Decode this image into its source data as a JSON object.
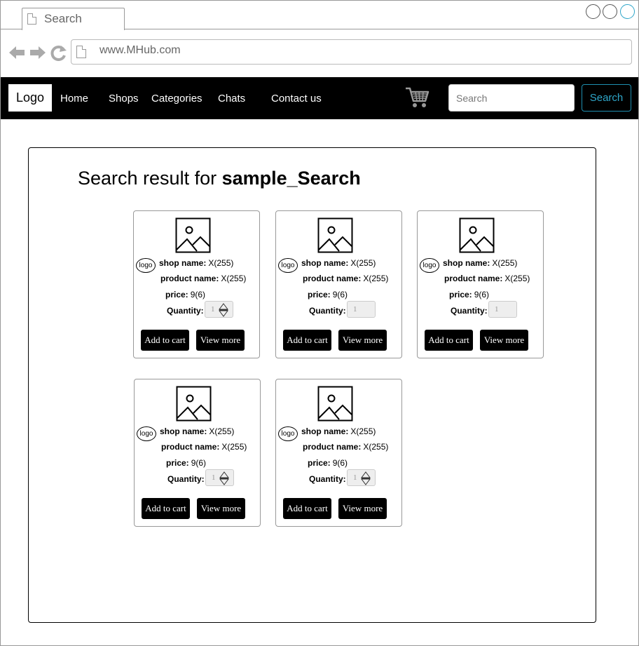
{
  "browser": {
    "tab_title": "Search",
    "url": "www.MHub.com"
  },
  "navbar": {
    "logo": "Logo",
    "links": [
      "Home",
      "Shops",
      "Categories",
      "Chats",
      "Contact us"
    ],
    "search_placeholder": "Search",
    "search_button": "Search"
  },
  "results": {
    "heading_prefix": "Search result for ",
    "query": "sample_Search"
  },
  "card_labels": {
    "shop_logo": "logo",
    "shop_name": "shop name:",
    "product_name": "product name:",
    "price": "price:",
    "quantity": "Quantity:",
    "add_to_cart": "Add to cart",
    "view_more": "View more"
  },
  "products": [
    {
      "shop_name": "X(255)",
      "product_name": "X(255)",
      "price": "9(6)",
      "quantity": "1",
      "has_spinner": true
    },
    {
      "shop_name": "X(255)",
      "product_name": "X(255)",
      "price": "9(6)",
      "quantity": "1",
      "has_spinner": false
    },
    {
      "shop_name": "X(255)",
      "product_name": "X(255)",
      "price": "9(6)",
      "quantity": "1",
      "has_spinner": false
    },
    {
      "shop_name": "X(255)",
      "product_name": "X(255)",
      "price": "9(6)",
      "quantity": "1",
      "has_spinner": true
    },
    {
      "shop_name": "X(255)",
      "product_name": "X(255)",
      "price": "9(6)",
      "quantity": "1",
      "has_spinner": true
    }
  ],
  "colors": {
    "navbar_bg": "#000000",
    "search_button_accent": "#2fa6c9",
    "window_button_active": "#2fa6c9"
  },
  "icons": [
    "document-icon",
    "back-arrow-icon",
    "forward-arrow-icon",
    "reload-icon",
    "cart-icon",
    "image-placeholder-icon",
    "spinner-arrows-icon"
  ]
}
